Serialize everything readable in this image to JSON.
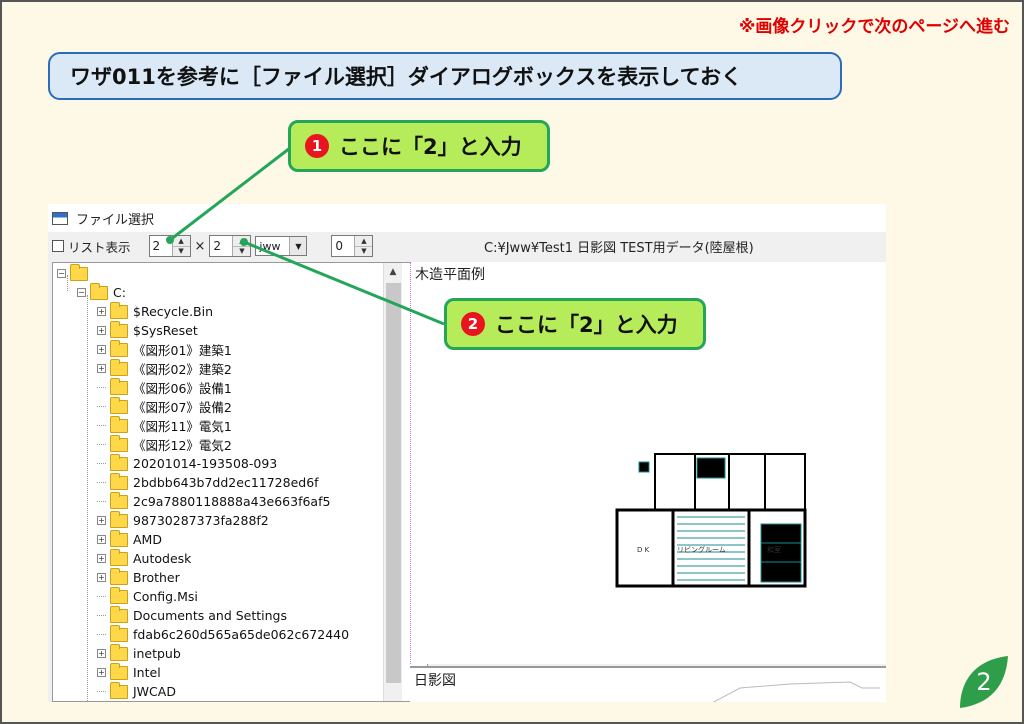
{
  "page": {
    "nav_note": "※画像クリックで次のページへ進む",
    "banner": "ワザ011を参考に［ファイル選択］ダイアログボックスを表示しておく",
    "page_number": "2"
  },
  "callouts": [
    {
      "num": "1",
      "text": "ここに「2」と入力"
    },
    {
      "num": "2",
      "text": "ここに「2」と入力"
    }
  ],
  "dialog": {
    "title": "ファイル選択",
    "list_view_label": "リスト表示",
    "rows_value": "2",
    "times": "×",
    "cols_value": "2",
    "ext_value": "jww",
    "offset_value": "0",
    "path": "C:¥Jww¥Test1  日影図  TEST用データ(陸屋根)"
  },
  "tree": {
    "root_expander": "⊟",
    "drive": "C:",
    "items": [
      {
        "label": "$Recycle.Bin",
        "expand": true
      },
      {
        "label": "$SysReset",
        "expand": true
      },
      {
        "label": "《図形01》建築1",
        "expand": true
      },
      {
        "label": "《図形02》建築2",
        "expand": true
      },
      {
        "label": "《図形06》設備1",
        "expand": false
      },
      {
        "label": "《図形07》設備2",
        "expand": false
      },
      {
        "label": "《図形11》電気1",
        "expand": false
      },
      {
        "label": "《図形12》電気2",
        "expand": false
      },
      {
        "label": "20201014-193508-093",
        "expand": false
      },
      {
        "label": "2bdbb643b7dd2ec11728ed6f",
        "expand": false
      },
      {
        "label": "2c9a7880118888a43e663f6af5",
        "expand": false
      },
      {
        "label": "98730287373fa288f2",
        "expand": true
      },
      {
        "label": "AMD",
        "expand": true
      },
      {
        "label": "Autodesk",
        "expand": true
      },
      {
        "label": "Brother",
        "expand": true
      },
      {
        "label": "Config.Msi",
        "expand": false
      },
      {
        "label": "Documents and Settings",
        "expand": false
      },
      {
        "label": "fdab6c260d565a65de062c672440",
        "expand": false
      },
      {
        "label": "inetpub",
        "expand": true
      },
      {
        "label": "Intel",
        "expand": true
      },
      {
        "label": "JWCAD",
        "expand": false
      }
    ]
  },
  "previews": [
    {
      "label": "木造平面例"
    },
    {
      "label": "日影図"
    }
  ],
  "plan_labels": {
    "dk": "D K",
    "living": "リビングルーム",
    "washitsu": "和室"
  },
  "colors": {
    "banner_border": "#2a6cb8",
    "callout_fill": "#b6ec5a",
    "callout_border": "#25a55a",
    "nav_note": "#e00000",
    "leaf": "#2f9e4a"
  }
}
